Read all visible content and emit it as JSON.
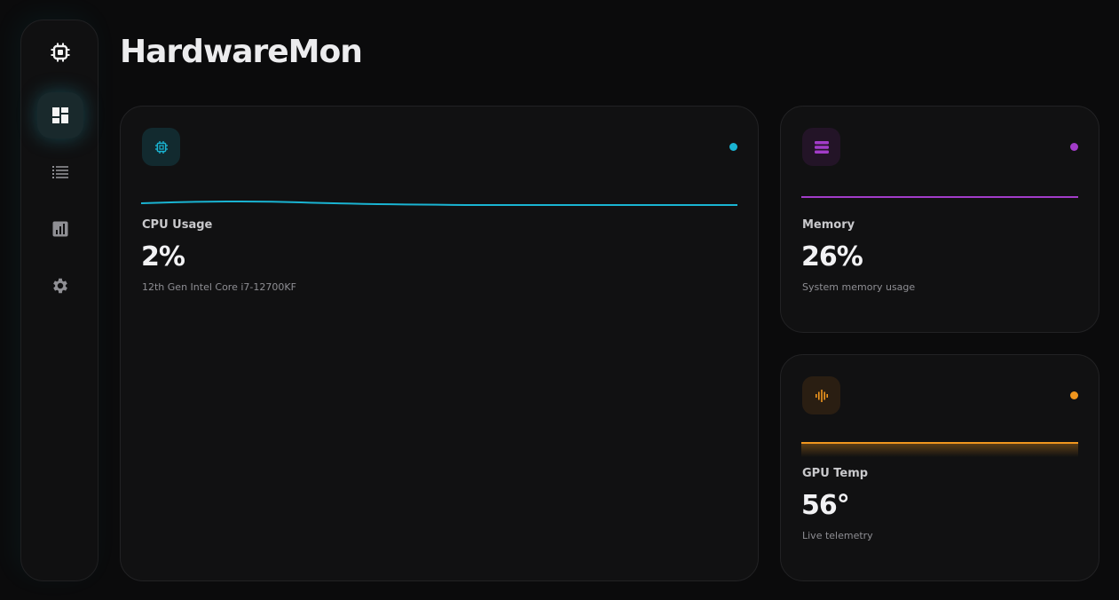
{
  "app": {
    "title": "HardwareMon"
  },
  "sidebar": {
    "items": [
      {
        "icon": "chip-icon",
        "active": false
      },
      {
        "icon": "dashboard-icon",
        "active": true
      },
      {
        "icon": "list-icon",
        "active": false
      },
      {
        "icon": "analytics-icon",
        "active": false
      },
      {
        "icon": "gear-icon",
        "active": false
      }
    ]
  },
  "cards": {
    "cpu": {
      "label": "CPU Usage",
      "value": "2%",
      "subtitle": "12th Gen Intel Core i7-12700KF",
      "icon": "cpu-icon",
      "accent": "#1ab4d2"
    },
    "memory": {
      "label": "Memory",
      "value": "26%",
      "subtitle": "System memory usage",
      "icon": "memory-icon",
      "accent": "#a23cc8"
    },
    "gpu": {
      "label": "GPU Temp",
      "value": "56°",
      "subtitle": "Live telemetry",
      "icon": "waveform-icon",
      "accent": "#f0961e"
    }
  }
}
